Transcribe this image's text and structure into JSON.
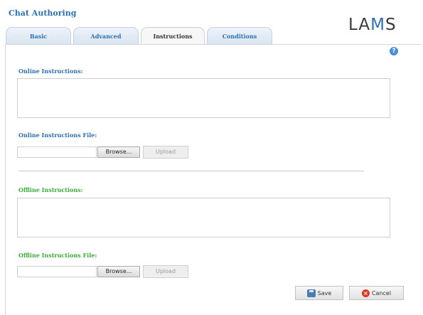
{
  "header": {
    "title": "Chat Authoring",
    "logo_text": "LAMS"
  },
  "tabs": [
    {
      "label": "Basic",
      "active": false
    },
    {
      "label": "Advanced",
      "active": false
    },
    {
      "label": "Instructions",
      "active": true
    },
    {
      "label": "Conditions",
      "active": false
    }
  ],
  "help": {
    "icon": "help-icon",
    "glyph": "?"
  },
  "online": {
    "instructions_label": "Online Instructions:",
    "instructions_value": "",
    "file_label": "Online Instructions File:",
    "browse_label": "Browse...",
    "upload_label": "Upload"
  },
  "offline": {
    "instructions_label": "Offline Instructions:",
    "instructions_value": "",
    "file_label": "Offline Instructions File:",
    "browse_label": "Browse...",
    "upload_label": "Upload"
  },
  "actions": {
    "save_label": "Save",
    "cancel_label": "Cancel"
  },
  "colors": {
    "accent_blue": "#2e6fb5",
    "accent_green": "#3cae3c",
    "cancel_red": "#d93a2b"
  }
}
